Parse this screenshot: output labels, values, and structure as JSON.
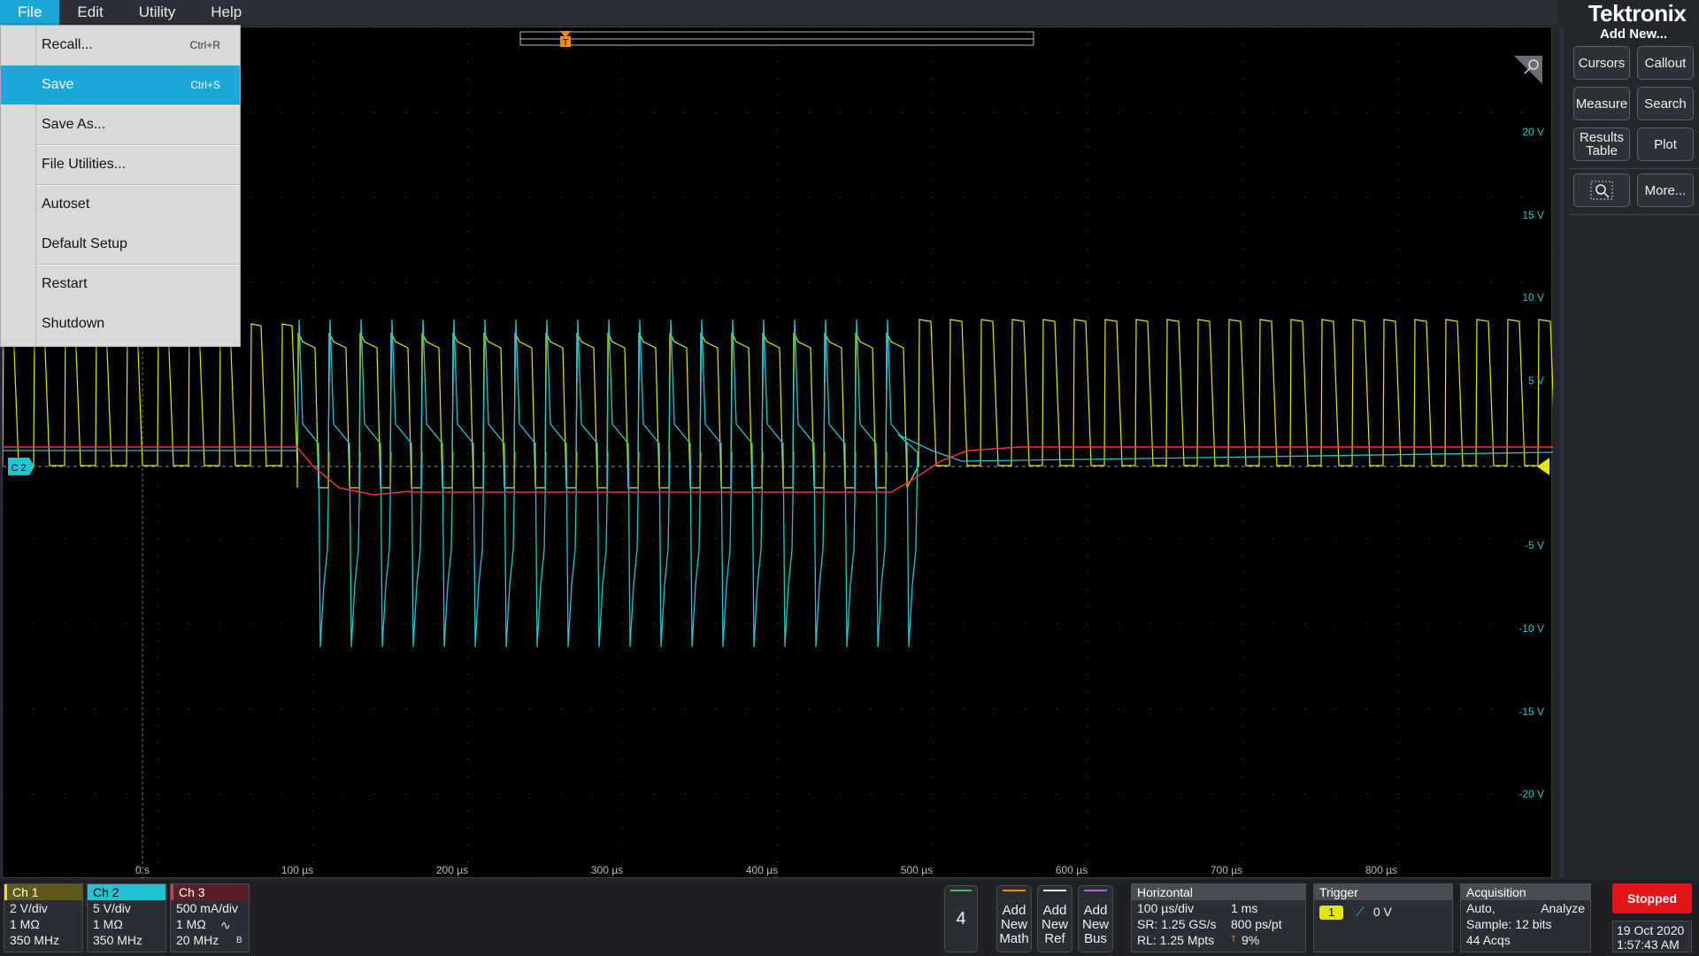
{
  "menu": {
    "items": [
      "File",
      "Edit",
      "Utility",
      "Help"
    ]
  },
  "brand": "Tektronix",
  "add_new": "Add New...",
  "file_menu": {
    "items": [
      {
        "label": "Recall...",
        "shortcut": "Ctrl+R"
      },
      {
        "label": "Save",
        "shortcut": "Ctrl+S"
      },
      {
        "label": "Save As...",
        "shortcut": ""
      },
      {
        "label": "File Utilities...",
        "shortcut": ""
      },
      {
        "label": "Autoset",
        "shortcut": ""
      },
      {
        "label": "Default Setup",
        "shortcut": ""
      },
      {
        "label": "Restart",
        "shortcut": ""
      },
      {
        "label": "Shutdown",
        "shortcut": ""
      }
    ],
    "highlighted": "Save"
  },
  "right_panel": {
    "cursors": "Cursors",
    "callout": "Callout",
    "measure": "Measure",
    "search": "Search",
    "results_table_1": "Results",
    "results_table_2": "Table",
    "plot": "Plot",
    "more": "More..."
  },
  "display": {
    "ch2_marker": "C 2",
    "y_labels": [
      "20 V",
      "15 V",
      "10 V",
      "5 V",
      "-5 V",
      "-10 V",
      "-15 V",
      "-20 V"
    ],
    "x_labels": [
      "0 s",
      "100 µs",
      "200 µs",
      "300 µs",
      "400 µs",
      "500 µs",
      "600 µs",
      "700 µs",
      "800 µs"
    ],
    "trigger_marker": "T"
  },
  "channels": [
    {
      "name": "Ch 1",
      "scale": "2 V/div",
      "impedance": "1 MΩ",
      "bandwidth": "350 MHz",
      "color": "#e6e600"
    },
    {
      "name": "Ch 2",
      "scale": "5 V/div",
      "impedance": "1 MΩ",
      "bandwidth": "350 MHz",
      "color": "#22c4d4"
    },
    {
      "name": "Ch 3",
      "scale": "500 mA/div",
      "impedance": "1 MΩ",
      "bandwidth": "20 MHz",
      "color": "#f0304a"
    }
  ],
  "bottom": {
    "channel_count": "4",
    "add_math": [
      "Add",
      "New",
      "Math"
    ],
    "add_ref": [
      "Add",
      "New",
      "Ref"
    ],
    "add_bus": [
      "Add",
      "New",
      "Bus"
    ],
    "horizontal": {
      "title": "Horizontal",
      "scale": "100 µs/div",
      "record_time": "1 ms",
      "sample_rate": "SR: 1.25 GS/s",
      "resolution": "800 ps/pt",
      "record_length": "RL: 1.25 Mpts",
      "position": "9%"
    },
    "trigger": {
      "title": "Trigger",
      "source": "1",
      "level": "0 V"
    },
    "acquisition": {
      "title": "Acquisition",
      "mode": "Auto,",
      "analyze": "Analyze",
      "sample": "Sample: 12 bits",
      "acqs": "44 Acqs"
    },
    "status": "Stopped",
    "date": "19 Oct 2020",
    "time": "1:57:43 AM"
  }
}
